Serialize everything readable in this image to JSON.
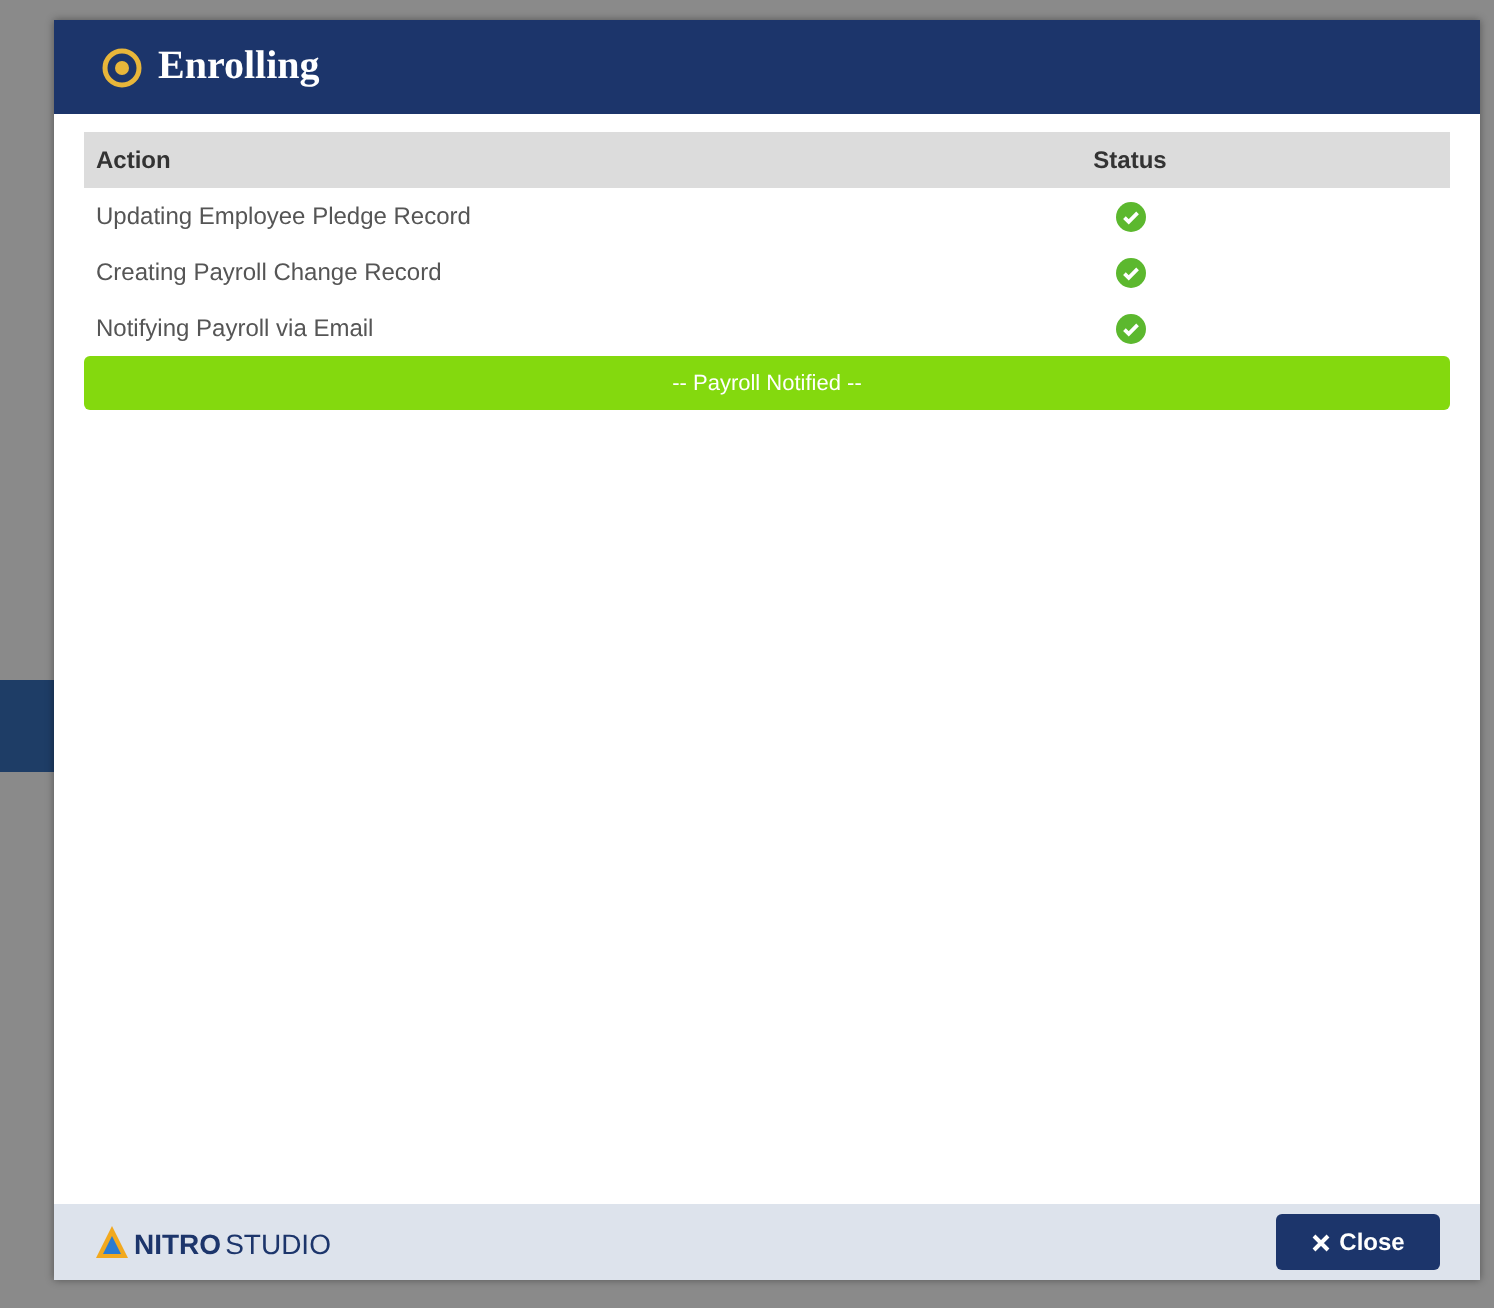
{
  "dialog": {
    "title": "Enrolling"
  },
  "table": {
    "columns": [
      "Action",
      "Status"
    ],
    "rows": [
      {
        "action": "Updating Employee Pledge Record",
        "complete": true
      },
      {
        "action": "Creating Payroll Change Record",
        "complete": true
      },
      {
        "action": "Notifying Payroll via Email",
        "complete": true
      }
    ]
  },
  "result_banner": {
    "text": "-- Payroll Notified --"
  },
  "footer": {
    "logo_bold": "NITRO",
    "logo_light": "STUDIO",
    "close_button": "Close"
  }
}
